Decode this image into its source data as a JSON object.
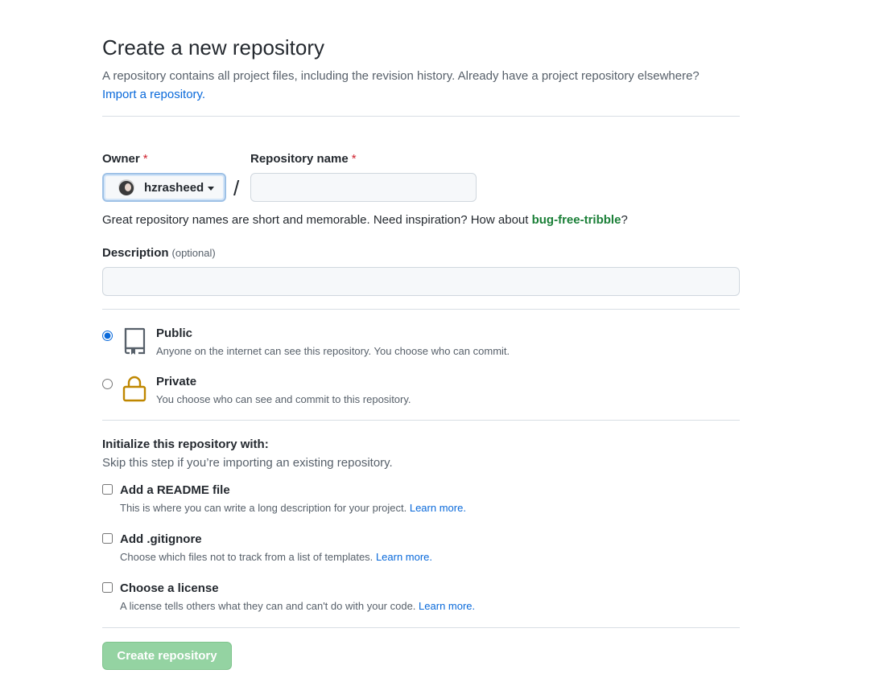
{
  "header": {
    "title": "Create a new repository",
    "subtitle": "A repository contains all project files, including the revision history. Already have a project repository elsewhere?",
    "import_link": "Import a repository."
  },
  "owner": {
    "label": "Owner",
    "required_mark": "*",
    "selected": "hzrasheed",
    "avatar_icon": "user-avatar"
  },
  "repo_name": {
    "label": "Repository name",
    "required_mark": "*",
    "value": "",
    "separator": "/"
  },
  "name_hint": {
    "text": "Great repository names are short and memorable. Need inspiration? How about ",
    "suggestion": "bug-free-tribble",
    "end": "?"
  },
  "description": {
    "label": "Description",
    "optional": "(optional)",
    "value": ""
  },
  "visibility": {
    "selected": "public",
    "options": [
      {
        "id": "public",
        "title": "Public",
        "desc": "Anyone on the internet can see this repository. You choose who can commit.",
        "icon": "repo-icon"
      },
      {
        "id": "private",
        "title": "Private",
        "desc": "You choose who can see and commit to this repository.",
        "icon": "lock-icon"
      }
    ]
  },
  "init": {
    "title": "Initialize this repository with:",
    "subtitle": "Skip this step if you’re importing an existing repository.",
    "items": [
      {
        "title": "Add a README file",
        "desc": "This is where you can write a long description for your project.",
        "link": "Learn more.",
        "checked": false
      },
      {
        "title": "Add .gitignore",
        "desc": "Choose which files not to track from a list of templates.",
        "link": "Learn more.",
        "checked": false
      },
      {
        "title": "Choose a license",
        "desc": "A license tells others what they can and can't do with your code.",
        "link": "Learn more.",
        "checked": false
      }
    ]
  },
  "submit": {
    "label": "Create repository",
    "enabled": false
  },
  "colors": {
    "link": "#0969da",
    "suggestion": "#1a7f37",
    "required": "#cf222e",
    "lock": "#bf8700",
    "submit_disabled": "#94d3a2"
  }
}
